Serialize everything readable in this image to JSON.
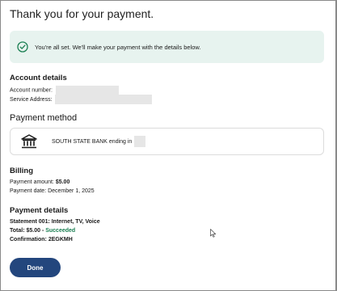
{
  "page": {
    "title": "Thank you for your payment."
  },
  "alert": {
    "message": "You're all set. We'll make your payment with the details below.",
    "icon": "check-circle-icon",
    "color": "#1a7f52",
    "background": "#e7f3ef"
  },
  "account": {
    "heading": "Account details",
    "account_number_label": "Account number:",
    "service_address_label": "Service Address:"
  },
  "payment_method": {
    "heading": "Payment method",
    "icon": "bank-icon",
    "text": "SOUTH STATE BANK ending in"
  },
  "billing": {
    "heading": "Billing",
    "amount_label": "Payment amount:",
    "amount_value": "$5.00",
    "date_label": "Payment date:",
    "date_value": "December 1, 2025"
  },
  "payment_details": {
    "heading": "Payment details",
    "statement": "Statement 001: Internet, TV, Voice",
    "total_label": "Total: $5.00 - ",
    "total_status": "Succeeded",
    "confirmation": "Confirmation: 2EGKMH"
  },
  "actions": {
    "done_label": "Done",
    "done_color": "#23467d"
  }
}
